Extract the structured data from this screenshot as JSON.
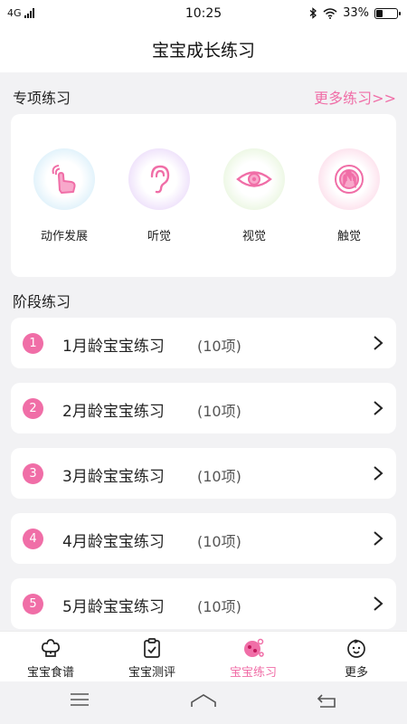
{
  "status": {
    "network": "4G",
    "time": "10:25",
    "battery_text": "33%",
    "battery_level": 0.33
  },
  "header": {
    "title": "宝宝成长练习"
  },
  "special": {
    "heading": "专项练习",
    "more_label": "更多练习>>",
    "items": [
      {
        "label": "动作发展",
        "icon": "hand-touch-icon",
        "color": "#f06ea7"
      },
      {
        "label": "听觉",
        "icon": "ear-icon",
        "color": "#f06ea7"
      },
      {
        "label": "视觉",
        "icon": "eye-icon",
        "color": "#f06ea7"
      },
      {
        "label": "触觉",
        "icon": "touch-icon",
        "color": "#f06ea7"
      }
    ]
  },
  "stage": {
    "heading": "阶段练习",
    "items": [
      {
        "num": "1",
        "name": "1月龄宝宝练习",
        "count": "(10项)"
      },
      {
        "num": "2",
        "name": "2月龄宝宝练习",
        "count": "(10项)"
      },
      {
        "num": "3",
        "name": "3月龄宝宝练习",
        "count": "(10项)"
      },
      {
        "num": "4",
        "name": "4月龄宝宝练习",
        "count": "(10项)"
      },
      {
        "num": "5",
        "name": "5月龄宝宝练习",
        "count": "(10项)"
      }
    ]
  },
  "tabs": [
    {
      "label": "宝宝食谱",
      "icon": "cook-hat-icon"
    },
    {
      "label": "宝宝测评",
      "icon": "clipboard-check-icon"
    },
    {
      "label": "宝宝练习",
      "icon": "practice-icon",
      "active": true
    },
    {
      "label": "更多",
      "icon": "baby-face-icon"
    }
  ],
  "colors": {
    "accent": "#f06ea7",
    "background": "#f2f2f4"
  }
}
